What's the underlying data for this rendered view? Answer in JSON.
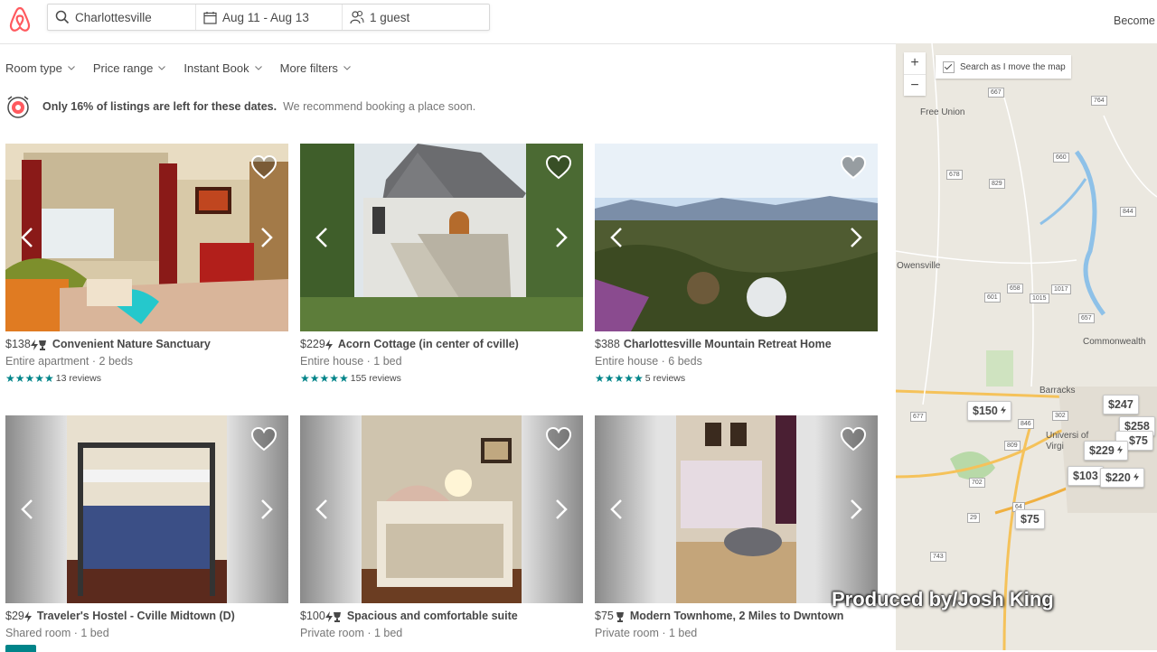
{
  "header": {
    "search_location": "Charlottesville",
    "dates": "Aug 11 - Aug 13",
    "guests": "1 guest",
    "become_host": "Become a host"
  },
  "filters": [
    "Room type",
    "Price range",
    "Instant Book",
    "More filters"
  ],
  "notice": {
    "bold": "Only 16% of listings are left for these dates.",
    "rest": "We recommend booking a place soon."
  },
  "listings": [
    {
      "price": "$138",
      "name": "Convenient Nature Sanctuary",
      "sub": "Entire apartment · 2 beds",
      "reviews": "13 reviews",
      "stars": "★★★★★"
    },
    {
      "price": "$229",
      "name": "Acorn Cottage (in center of cville)",
      "sub": "Entire house · 1 bed",
      "reviews": "155 reviews",
      "stars": "★★★★★"
    },
    {
      "price": "$388",
      "name": "Charlottesville Mountain Retreat Home",
      "sub": "Entire house · 6 beds",
      "reviews": "5 reviews",
      "stars": "★★★★★"
    },
    {
      "price": "$29",
      "name": "Traveler's Hostel - Cville Midtown (D)",
      "sub": "Shared room · 1 bed"
    },
    {
      "price": "$100",
      "name": "Spacious and comfortable suite",
      "sub": "Private room · 1 bed"
    },
    {
      "price": "$75",
      "name": "Modern Townhome, 2 Miles to Dwntown",
      "sub": "Private room · 1 bed"
    }
  ],
  "map": {
    "search_as_move": "Search as I move the map",
    "zoom_in": "+",
    "zoom_out": "−",
    "places": [
      "Free Union",
      "Owensville",
      "Commonwealth",
      "Barracks",
      "Universi of Virgi"
    ],
    "roads": [
      "667",
      "764",
      "678",
      "829",
      "660",
      "844",
      "601",
      "658",
      "1015",
      "1017",
      "657",
      "677",
      "846",
      "302",
      "809",
      "702",
      "29",
      "64",
      "743"
    ],
    "pins": [
      "$150",
      "$247",
      "$258",
      "$75",
      "$229",
      "$103",
      "$220",
      "$75"
    ]
  },
  "watermark": "Produced by/Josh King",
  "colors": {
    "brand": "#FF5A5F",
    "teal": "#008489",
    "text": "#484848",
    "muted": "#767676"
  }
}
